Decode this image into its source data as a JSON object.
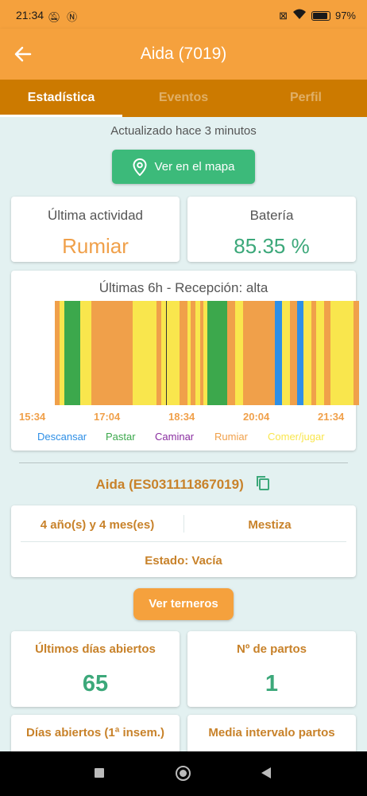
{
  "status_bar": {
    "time": "21:34",
    "battery": "97%",
    "icons": [
      "bell-off-icon",
      "nfc-icon",
      "sim-off-icon",
      "wifi-icon",
      "battery-icon"
    ]
  },
  "app_bar": {
    "title": "Aida (7019)",
    "back_icon": "arrow-left-icon"
  },
  "tabs": [
    {
      "label": "Estadística",
      "active": true
    },
    {
      "label": "Eventos",
      "active": false
    },
    {
      "label": "Perfil",
      "active": false
    }
  ],
  "updated_text": "Actualizado hace 3 minutos",
  "map_button": {
    "label": "Ver en el mapa",
    "icon": "map-pin-icon"
  },
  "cards": {
    "activity": {
      "label": "Última actividad",
      "value": "Rumiar",
      "color": "#f0a04a"
    },
    "battery": {
      "label": "Batería",
      "value": "85.35 %",
      "color": "#3ca87a"
    }
  },
  "activity_chart": {
    "title": "Últimas 6h - Recepción: alta",
    "ticks": [
      "15:34",
      "17:04",
      "18:34",
      "20:04",
      "21:34"
    ],
    "legend": [
      {
        "name": "Descansar",
        "color": "#2e8fe6"
      },
      {
        "name": "Pastar",
        "color": "#3ca84c"
      },
      {
        "name": "Caminar",
        "color": "#8a2ea0"
      },
      {
        "name": "Rumiar",
        "color": "#f0a04a"
      },
      {
        "name": "Comer/jugar",
        "color": "#f9e64d"
      }
    ]
  },
  "animal": {
    "id_label": "Aida (ES031111867019)",
    "copy_icon": "copy-icon",
    "age": "4 año(s) y 4 mes(es)",
    "breed": "Mestiza",
    "state": "Estado: Vacía"
  },
  "calves_button": "Ver terneros",
  "stats": [
    {
      "label": "Últimos días abiertos",
      "value": "65"
    },
    {
      "label": "Nº de partos",
      "value": "1"
    },
    {
      "label": "Días abiertos (1ª insem.)",
      "value": ""
    },
    {
      "label": "Media intervalo partos",
      "value": ""
    }
  ],
  "colors": {
    "primary": "#f5a13d",
    "tab_bar": "#cc7a00",
    "accent_green": "#3cba7a",
    "label_brown": "#c8822a",
    "background": "#e3f1f1"
  }
}
